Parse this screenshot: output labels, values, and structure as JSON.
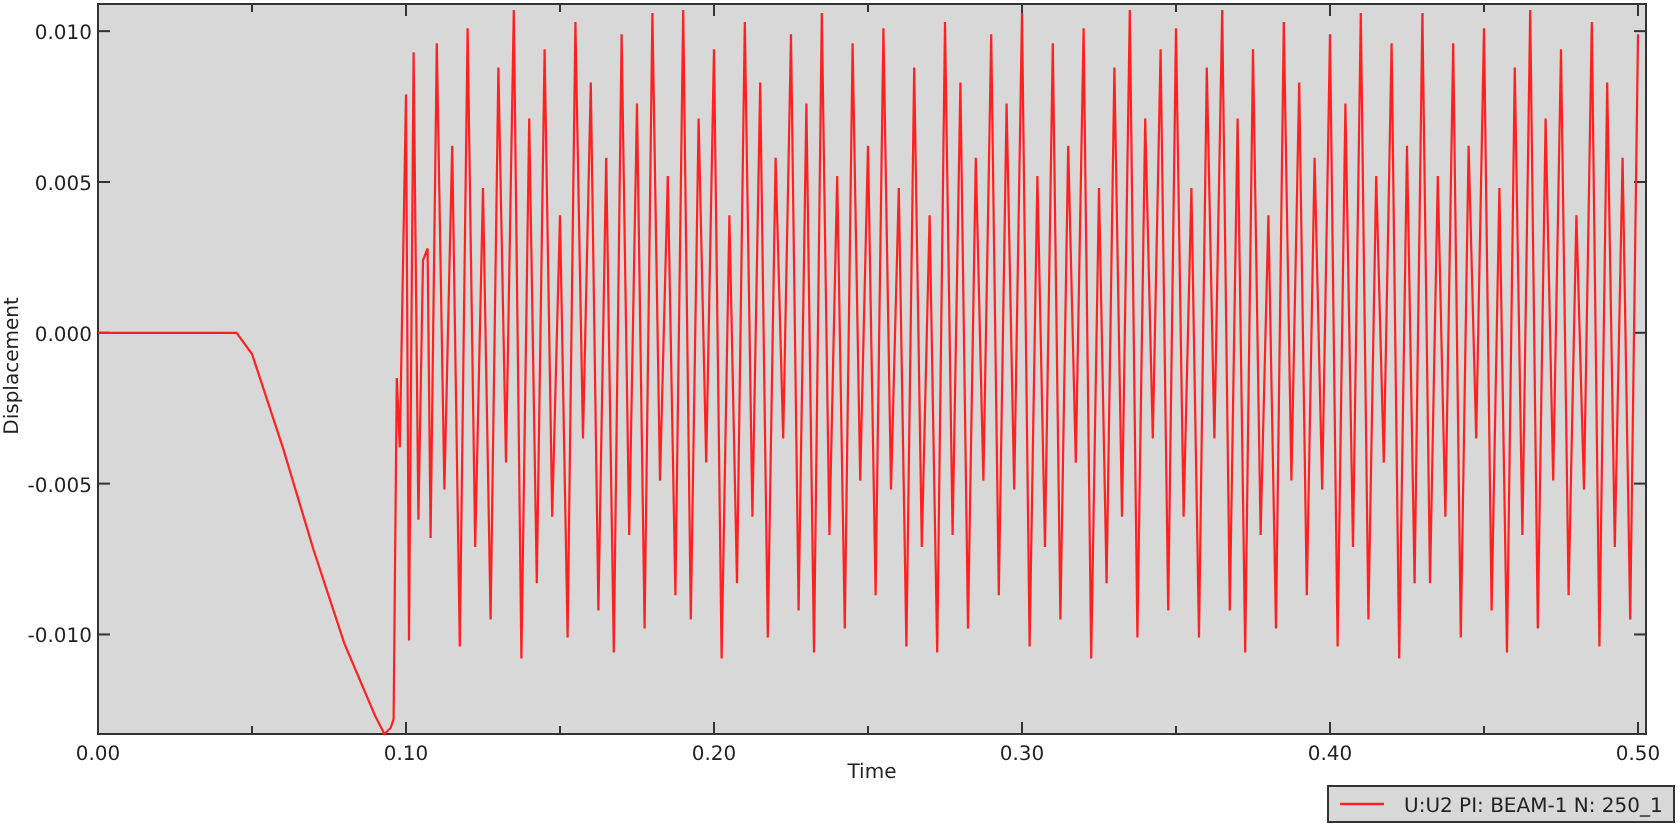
{
  "plot": {
    "chart_data": {
      "type": "line",
      "xlabel": "Time",
      "ylabel": "Displacement",
      "xlim": [
        0,
        0.5026
      ],
      "ylim": [
        -0.0133,
        0.0109
      ],
      "xticks": [
        {
          "value": 0,
          "label": "0.00"
        },
        {
          "value": 0.1,
          "label": "0.10"
        },
        {
          "value": 0.2,
          "label": "0.20"
        },
        {
          "value": 0.3,
          "label": "0.30"
        },
        {
          "value": 0.4,
          "label": "0.40"
        },
        {
          "value": 0.5,
          "label": "0.50"
        }
      ],
      "yticks": [
        {
          "value": -0.01,
          "label": "-0.010"
        },
        {
          "value": -0.005,
          "label": "-0.005"
        },
        {
          "value": 0,
          "label": "0.000"
        },
        {
          "value": 0.005,
          "label": "0.005"
        },
        {
          "value": 0.01,
          "label": "0.010"
        }
      ],
      "x": [
        0,
        0.045,
        0.05,
        0.06,
        0.07,
        0.08,
        0.09,
        0.093,
        0.095,
        0.096,
        0.097,
        0.098,
        0.1,
        0.101,
        0.1025,
        0.104,
        0.1055,
        0.107,
        0.108,
        0.11,
        0.1125,
        0.115,
        0.1175,
        0.12,
        0.1225,
        0.125,
        0.1275,
        0.13,
        0.1325,
        0.135,
        0.1375,
        0.14,
        0.1425,
        0.145,
        0.1475,
        0.15,
        0.1525,
        0.155,
        0.1575,
        0.16,
        0.1625,
        0.165,
        0.1675,
        0.17,
        0.1725,
        0.175,
        0.1775,
        0.18,
        0.1825,
        0.185,
        0.1875,
        0.19,
        0.1925,
        0.195,
        0.1975,
        0.2,
        0.2025,
        0.205,
        0.2075,
        0.21,
        0.2125,
        0.215,
        0.2175,
        0.22,
        0.2225,
        0.225,
        0.2275,
        0.23,
        0.2325,
        0.235,
        0.2375,
        0.24,
        0.2425,
        0.245,
        0.2475,
        0.25,
        0.2525,
        0.255,
        0.2575,
        0.26,
        0.2625,
        0.265,
        0.2675,
        0.27,
        0.2725,
        0.275,
        0.2775,
        0.28,
        0.2825,
        0.285,
        0.2875,
        0.29,
        0.2925,
        0.295,
        0.2975,
        0.3,
        0.3025,
        0.305,
        0.3075,
        0.31,
        0.3125,
        0.315,
        0.3175,
        0.32,
        0.3225,
        0.325,
        0.3275,
        0.33,
        0.3325,
        0.335,
        0.3375,
        0.34,
        0.3425,
        0.345,
        0.3475,
        0.35,
        0.3525,
        0.355,
        0.3575,
        0.36,
        0.3625,
        0.365,
        0.3675,
        0.37,
        0.3725,
        0.375,
        0.3775,
        0.38,
        0.3825,
        0.385,
        0.3875,
        0.39,
        0.3925,
        0.395,
        0.3975,
        0.4,
        0.4025,
        0.405,
        0.4075,
        0.41,
        0.4125,
        0.415,
        0.4175,
        0.42,
        0.4225,
        0.425,
        0.4275,
        0.43,
        0.4325,
        0.435,
        0.4375,
        0.44,
        0.4425,
        0.445,
        0.4475,
        0.45,
        0.4525,
        0.455,
        0.4575,
        0.46,
        0.4625,
        0.465,
        0.4675,
        0.47,
        0.4725,
        0.475,
        0.4775,
        0.48,
        0.4825,
        0.485,
        0.4875,
        0.49,
        0.4925,
        0.495,
        0.4975,
        0.5
      ],
      "series": [
        {
          "name": "U:U2 PI: BEAM-1 N: 250_1",
          "color": "#ff2020",
          "values": [
            0,
            0,
            -0.0007,
            -0.0038,
            -0.0072,
            -0.0103,
            -0.0127,
            -0.0133,
            -0.0131,
            -0.0128,
            -0.0015,
            -0.0038,
            0.0079,
            -0.0102,
            0.0093,
            -0.0062,
            0.0024,
            0.0028,
            -0.0068,
            0.0096,
            -0.0052,
            0.0062,
            -0.0104,
            0.0101,
            -0.0071,
            0.0048,
            -0.0095,
            0.0088,
            -0.0043,
            0.0107,
            -0.0108,
            0.0071,
            -0.0083,
            0.0094,
            -0.0061,
            0.0039,
            -0.0101,
            0.0103,
            -0.0035,
            0.0083,
            -0.0092,
            0.0058,
            -0.0106,
            0.0099,
            -0.0067,
            0.0076,
            -0.0098,
            0.0106,
            -0.0049,
            0.0052,
            -0.0087,
            0.0107,
            -0.0095,
            0.0071,
            -0.0043,
            0.0094,
            -0.0108,
            0.0039,
            -0.0083,
            0.0103,
            -0.0061,
            0.0083,
            -0.0101,
            0.0058,
            -0.0035,
            0.0099,
            -0.0092,
            0.0076,
            -0.0106,
            0.0106,
            -0.0067,
            0.0052,
            -0.0098,
            0.0096,
            -0.0049,
            0.0062,
            -0.0087,
            0.0101,
            -0.0052,
            0.0048,
            -0.0104,
            0.0088,
            -0.0071,
            0.0039,
            -0.0106,
            0.0103,
            -0.0067,
            0.0083,
            -0.0098,
            0.0058,
            -0.0049,
            0.0099,
            -0.0087,
            0.0076,
            -0.0052,
            0.0106,
            -0.0104,
            0.0052,
            -0.0071,
            0.0096,
            -0.0095,
            0.0062,
            -0.0043,
            0.0101,
            -0.0108,
            0.0048,
            -0.0083,
            0.0088,
            -0.0061,
            0.0107,
            -0.0101,
            0.0071,
            -0.0035,
            0.0094,
            -0.0092,
            0.0101,
            -0.0061,
            0.0048,
            -0.0101,
            0.0088,
            -0.0035,
            0.0107,
            -0.0092,
            0.0071,
            -0.0106,
            0.0094,
            -0.0067,
            0.0039,
            -0.0098,
            0.0103,
            -0.0049,
            0.0083,
            -0.0087,
            0.0058,
            -0.0052,
            0.0099,
            -0.0104,
            0.0076,
            -0.0071,
            0.0106,
            -0.0095,
            0.0052,
            -0.0043,
            0.0096,
            -0.0108,
            0.0062,
            -0.0083,
            0.0106,
            -0.0083,
            0.0052,
            -0.0061,
            0.0096,
            -0.0101,
            0.0062,
            -0.0035,
            0.0101,
            -0.0092,
            0.0048,
            -0.0106,
            0.0088,
            -0.0067,
            0.0107,
            -0.0098,
            0.0071,
            -0.0049,
            0.0094,
            -0.0087,
            0.0039,
            -0.0052,
            0.0103,
            -0.0104,
            0.0083,
            -0.0071,
            0.0058,
            -0.0095,
            0.0099
          ]
        }
      ]
    }
  }
}
